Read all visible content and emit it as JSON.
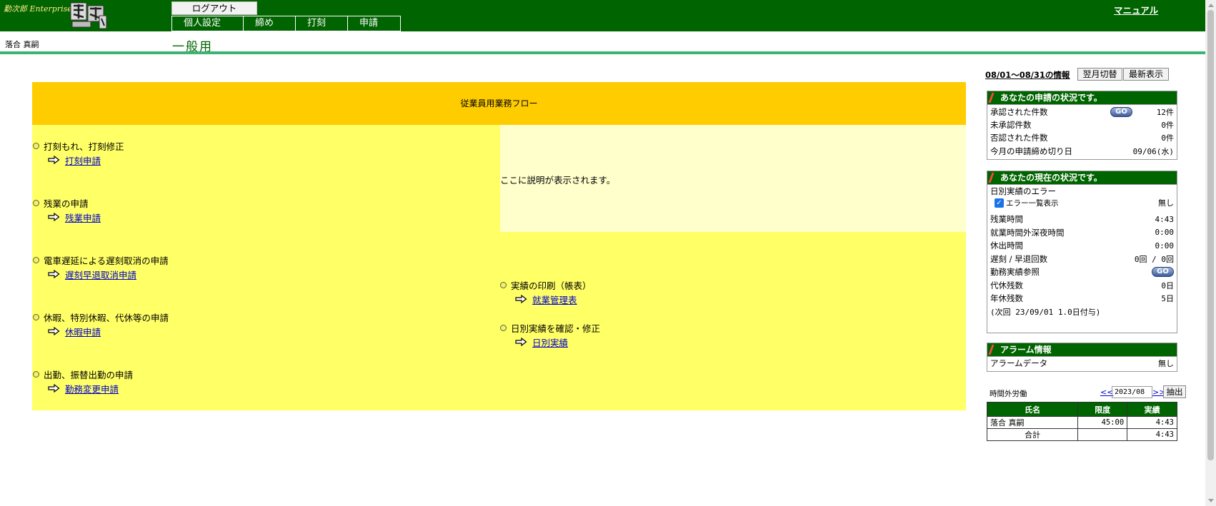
{
  "header": {
    "brand": "勤次郎 Enterprise",
    "logout_label": "ログアウト",
    "menu": [
      {
        "label": "個人設定"
      },
      {
        "label": "締め"
      },
      {
        "label": "打刻"
      },
      {
        "label": "申請"
      }
    ],
    "manual_label": "マニュアル"
  },
  "user_name": "落合 真嗣",
  "page_title": "一般用",
  "flow": {
    "title": "従業員用業務フロー",
    "description": "ここに説明が表示されます。",
    "items_left": [
      {
        "label": "打刻もれ、打刻修正",
        "link": "打刻申請"
      },
      {
        "label": "残業の申請",
        "link": "残業申請"
      },
      {
        "label": "電車遅延による遅刻取消の申請",
        "link": "遅刻早退取消申請"
      },
      {
        "label": "休暇、特別休暇、代休等の申請",
        "link": "休暇申請"
      },
      {
        "label": "出勤、振替出勤の申請",
        "link": "勤務変更申請"
      }
    ],
    "items_right": [
      {
        "label": "実績の印刷（帳表）",
        "link": "就業管理表"
      },
      {
        "label": "日別実績を確認・修正",
        "link": "日別実績"
      }
    ]
  },
  "side": {
    "period_label": "08/01〜08/31の情報",
    "next_month_label": "翌月切替",
    "refresh_label": "最新表示",
    "applications": {
      "title": "あなたの申請の状況です。",
      "go_label": "GO",
      "rows": [
        {
          "label": "承認された件数",
          "value": "12件"
        },
        {
          "label": "未承認件数",
          "value": "0件"
        },
        {
          "label": "否認された件数",
          "value": "0件"
        },
        {
          "label": "今月の申請締め切り日",
          "value": "09/06(水)"
        }
      ]
    },
    "status": {
      "title": "あなたの現在の状況です。",
      "error_label": "日別実績のエラー",
      "error_list_label": "エラー一覧表示",
      "error_value": "無し",
      "overtime_label": "残業時間",
      "overtime_value": "4:43",
      "late_night_label": "就業時間外深夜時間",
      "late_night_value": "0:00",
      "holiday_label": "休出時間",
      "holiday_value": "0:00",
      "late_early_label": "遅刻 / 早退回数",
      "late_early_value": "0回 / 0回",
      "record_ref_label": "勤務実績参照",
      "go_label": "GO",
      "comp_leave_label": "代休残数",
      "comp_leave_value": "0日",
      "annual_leave_label": "年休残数",
      "annual_leave_value": "5日",
      "next_grant_note": "(次回 23/09/01 1.0日付与)"
    },
    "alarm": {
      "title": "アラーム情報",
      "data_label": "アラームデータ",
      "data_value": "無し"
    },
    "overtime": {
      "title": "時間外労働",
      "prev": "<<",
      "next": ">>",
      "month": "2023/08",
      "extract_label": "抽出",
      "headers": {
        "name": "氏名",
        "limit": "限度",
        "actual": "実績"
      },
      "row": {
        "name": "落合 真嗣",
        "limit": "45:00",
        "actual": "4:43"
      },
      "total": {
        "label": "合計",
        "limit": "",
        "actual": "4:43"
      }
    }
  },
  "colors": {
    "header_bg": "#006400",
    "flow_header": "#ffcc00",
    "flow_body": "#ffff66",
    "desc_box": "#ffffcc",
    "accent_bar": "#3cb371"
  },
  "icons": {
    "flow_arrow": "arrow-right-outline-icon",
    "logo": "kinjiro-logo"
  }
}
